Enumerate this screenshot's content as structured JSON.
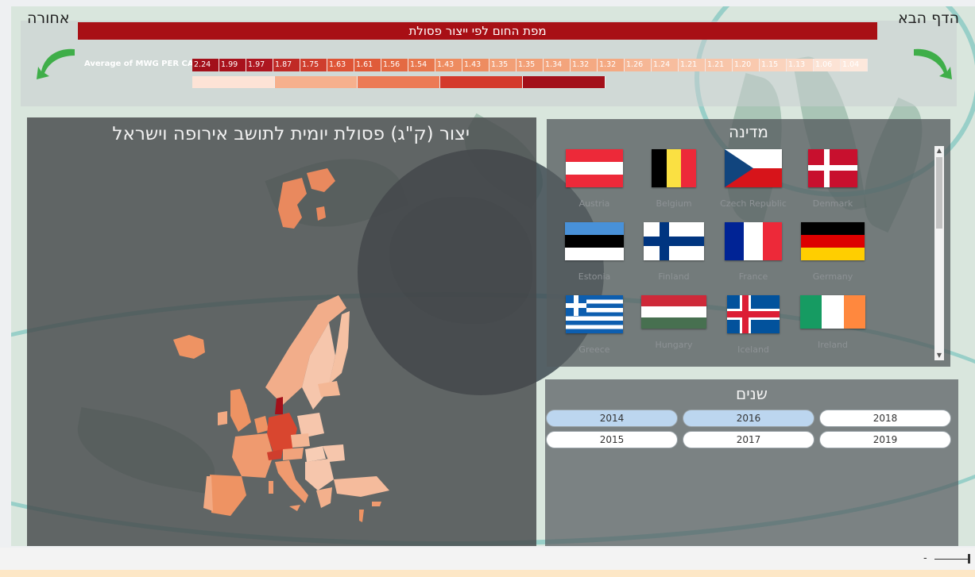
{
  "header": {
    "title": "מפת החום לפי ייצור פסולת",
    "back_label": "אחורה",
    "next_label": "הדף הבא"
  },
  "heatstrip": {
    "label": "Average of MWG PER CAP.",
    "values": [
      "2.24",
      "1.99",
      "1.97",
      "1.87",
      "1.75",
      "1.63",
      "1.61",
      "1.56",
      "1.54",
      "1.43",
      "1.43",
      "1.35",
      "1.35",
      "1.34",
      "1.32",
      "1.32",
      "1.26",
      "1.24",
      "1.21",
      "1.21",
      "1.20",
      "1.15",
      "1.13",
      "1.06",
      "1.04"
    ],
    "colors": [
      "#a3101a",
      "#a8121c",
      "#ae1620",
      "#c02a26",
      "#cf3e2d",
      "#de5436",
      "#e05b39",
      "#e46a43",
      "#e8774d",
      "#ee8c60",
      "#ee8c60",
      "#f29f76",
      "#f29f76",
      "#f3a47c",
      "#f4a982",
      "#f4a982",
      "#f6b796",
      "#f7bd9e",
      "#f8c5a9",
      "#f8c5a9",
      "#f9c9ae",
      "#fad3bd",
      "#fbd9c6",
      "#fce3d5",
      "#fde8dc"
    ],
    "legend_colors": [
      "#fde3d6",
      "#f6b08d",
      "#ec7a55",
      "#d4392b",
      "#a3101a"
    ]
  },
  "map_panel": {
    "title": "יצור (ק\"ג) פסולת יומית לתושב אירופה וישראל"
  },
  "country_slicer": {
    "title": "מדינה",
    "countries": [
      "Austria",
      "Belgium",
      "Czech Republic",
      "Denmark",
      "Estonia",
      "Finland",
      "France",
      "Germany",
      "Greece",
      "Hungary",
      "Iceland",
      "Ireland"
    ]
  },
  "years_slicer": {
    "title": "שנים",
    "years": [
      "2014",
      "2016",
      "2018",
      "2015",
      "2017",
      "2019"
    ],
    "selected": [
      "2014",
      "2016"
    ]
  },
  "footer": {
    "zoom_minus": "-"
  },
  "colors": {
    "title_red": "#a80f15",
    "panel_dark": "#46484a",
    "selected_year": "#bcd6ef",
    "arrow_green": "#3fae49"
  }
}
